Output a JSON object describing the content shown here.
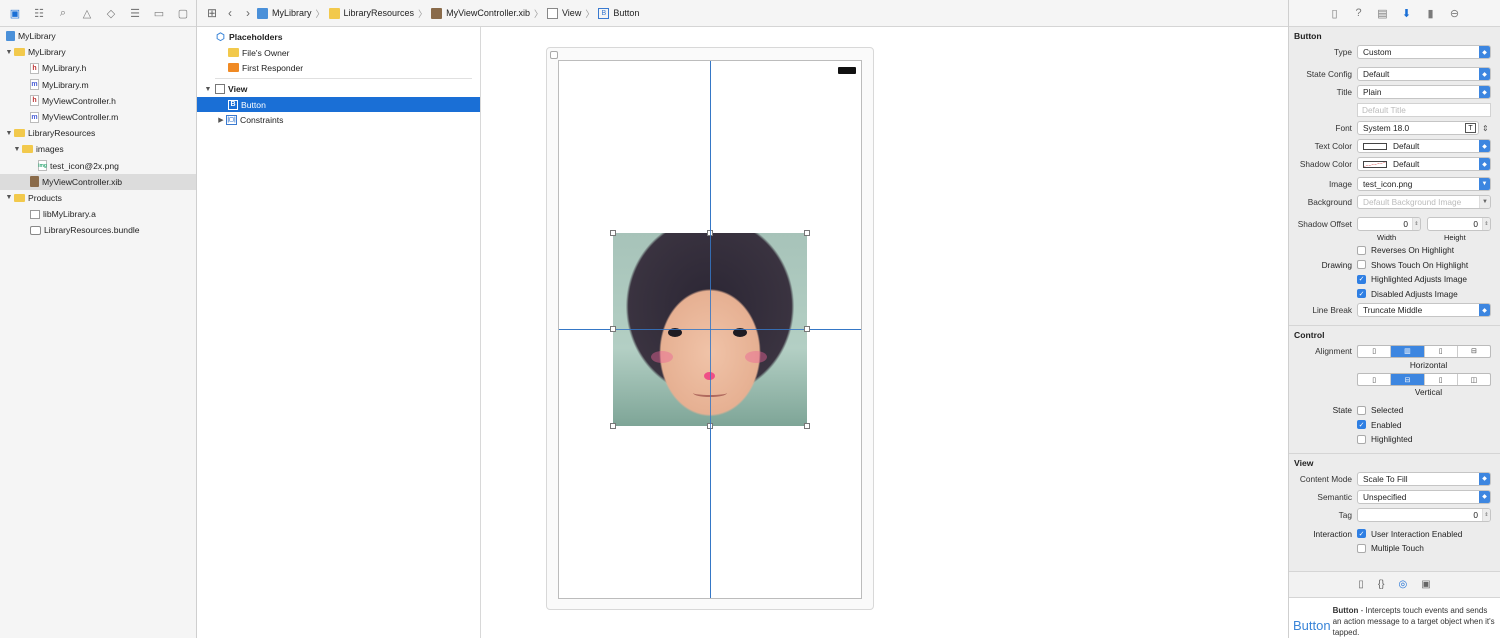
{
  "navigator": {
    "toolbar_icons": [
      "folder-icon",
      "hierarchy-icon",
      "search-icon",
      "warning-icon",
      "test-icon",
      "debug-icon",
      "breakpoint-icon",
      "report-icon"
    ],
    "tree": [
      {
        "label": "MyLibrary",
        "icon": "project",
        "level": 0,
        "disclosure": ""
      },
      {
        "label": "MyLibrary",
        "icon": "folder",
        "level": 0,
        "disclosure": "open"
      },
      {
        "label": "MyLibrary.h",
        "icon": "h",
        "level": 2,
        "disclosure": ""
      },
      {
        "label": "MyLibrary.m",
        "icon": "m",
        "level": 2,
        "disclosure": ""
      },
      {
        "label": "MyViewController.h",
        "icon": "h",
        "level": 2,
        "disclosure": ""
      },
      {
        "label": "MyViewController.m",
        "icon": "m",
        "level": 2,
        "disclosure": ""
      },
      {
        "label": "LibraryResources",
        "icon": "folder",
        "level": 0,
        "disclosure": "open"
      },
      {
        "label": "images",
        "icon": "folder",
        "level": 1,
        "disclosure": "open"
      },
      {
        "label": "test_icon@2x.png",
        "icon": "png",
        "level": 3,
        "disclosure": ""
      },
      {
        "label": "MyViewController.xib",
        "icon": "xib",
        "level": 2,
        "disclosure": "",
        "selected": true
      },
      {
        "label": "Products",
        "icon": "folder",
        "level": 0,
        "disclosure": "open"
      },
      {
        "label": "libMyLibrary.a",
        "icon": "lib",
        "level": 2,
        "disclosure": ""
      },
      {
        "label": "LibraryResources.bundle",
        "icon": "bundle",
        "level": 2,
        "disclosure": ""
      }
    ]
  },
  "jumpbar": {
    "crumbs": [
      "MyLibrary",
      "LibraryResources",
      "MyViewController.xib",
      "View",
      "Button"
    ]
  },
  "outline": {
    "placeholders_label": "Placeholders",
    "files_owner": "File's Owner",
    "first_responder": "First Responder",
    "view_label": "View",
    "button_label": "Button",
    "constraints_label": "Constraints"
  },
  "inspector": {
    "button_section": "Button",
    "type_label": "Type",
    "type_value": "Custom",
    "state_config_label": "State Config",
    "state_config_value": "Default",
    "title_label": "Title",
    "title_value": "Plain",
    "title_placeholder": "Default Title",
    "font_label": "Font",
    "font_value": "System 18.0",
    "text_color_label": "Text Color",
    "text_color_value": "Default",
    "shadow_color_label": "Shadow Color",
    "shadow_color_value": "Default",
    "image_label": "Image",
    "image_value": "test_icon.png",
    "background_label": "Background",
    "background_placeholder": "Default Background Image",
    "shadow_offset_label": "Shadow Offset",
    "shadow_w": "0",
    "shadow_h": "0",
    "width_label": "Width",
    "height_label": "Height",
    "drawing_label": "Drawing",
    "reverses": "Reverses On Highlight",
    "reverses_on": false,
    "shows_touch": "Shows Touch On Highlight",
    "shows_touch_on": false,
    "highlighted_adjusts": "Highlighted Adjusts Image",
    "highlighted_adjusts_on": true,
    "disabled_adjusts": "Disabled Adjusts Image",
    "disabled_adjusts_on": true,
    "line_break_label": "Line Break",
    "line_break_value": "Truncate Middle",
    "control_section": "Control",
    "alignment_label": "Alignment",
    "horizontal_label": "Horizontal",
    "vertical_label": "Vertical",
    "state_label": "State",
    "selected": "Selected",
    "selected_on": false,
    "enabled": "Enabled",
    "enabled_on": true,
    "highlighted": "Highlighted",
    "highlighted_on": false,
    "view_section": "View",
    "content_mode_label": "Content Mode",
    "content_mode_value": "Scale To Fill",
    "semantic_label": "Semantic",
    "semantic_value": "Unspecified",
    "tag_label": "Tag",
    "tag_value": "0",
    "interaction_label": "Interaction",
    "user_interaction": "User Interaction Enabled",
    "user_interaction_on": true,
    "multiple_touch": "Multiple Touch",
    "multiple_touch_on": false,
    "help_title": "Button",
    "help_name": "Button",
    "help_desc": " - Intercepts touch events and sends an action message to a target object when it's tapped."
  },
  "colors": {
    "accent": "#1a6fd6",
    "guide": "#3577c6",
    "popup_arrow": "#3d86e0"
  }
}
